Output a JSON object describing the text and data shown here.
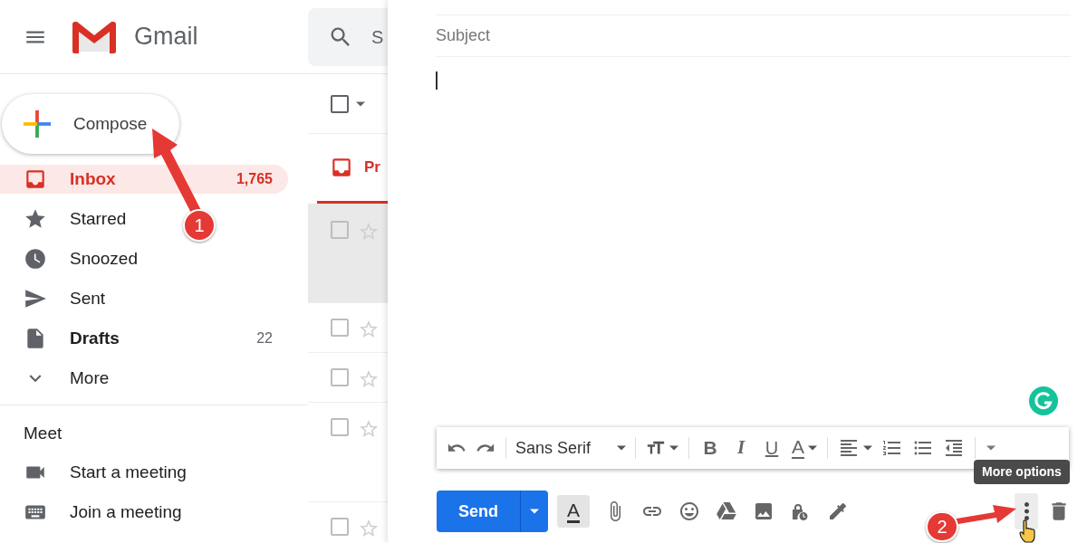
{
  "header": {
    "product": "Gmail",
    "search_placeholder": "S"
  },
  "compose_button": {
    "label": "Compose"
  },
  "nav": [
    {
      "label": "Inbox",
      "count": "1,765",
      "selected": true,
      "bold": true
    },
    {
      "label": "Starred",
      "selected": false,
      "bold": false
    },
    {
      "label": "Snoozed",
      "selected": false,
      "bold": false
    },
    {
      "label": "Sent",
      "selected": false,
      "bold": false
    },
    {
      "label": "Drafts",
      "count": "22",
      "selected": false,
      "bold": true
    },
    {
      "label": "More",
      "selected": false,
      "bold": false
    }
  ],
  "meet": {
    "title": "Meet",
    "items": [
      {
        "label": "Start a meeting"
      },
      {
        "label": "Join a meeting"
      }
    ]
  },
  "mail_list": {
    "select_all": {
      "checked": false
    },
    "tab": {
      "label": "Pr",
      "selected": true
    },
    "rows": [
      {
        "shaded": true,
        "checked": false,
        "starred": false
      },
      {
        "shaded": false,
        "checked": false,
        "starred": false
      },
      {
        "shaded": false,
        "checked": false,
        "starred": false
      },
      {
        "shaded": false,
        "checked": false,
        "starred": false
      },
      {
        "shaded": false,
        "checked": false,
        "starred": false
      }
    ]
  },
  "compose": {
    "subject_placeholder": "Subject",
    "toolbar": {
      "font": "Sans Serif",
      "bold": "B",
      "italic": "I",
      "underline": "U",
      "text_color": "A"
    },
    "send": "Send",
    "formatting_toggle": {
      "label": "A",
      "selected": true
    },
    "tooltip": "More options"
  },
  "annotations": [
    {
      "label": "1"
    },
    {
      "label": "2"
    }
  ]
}
